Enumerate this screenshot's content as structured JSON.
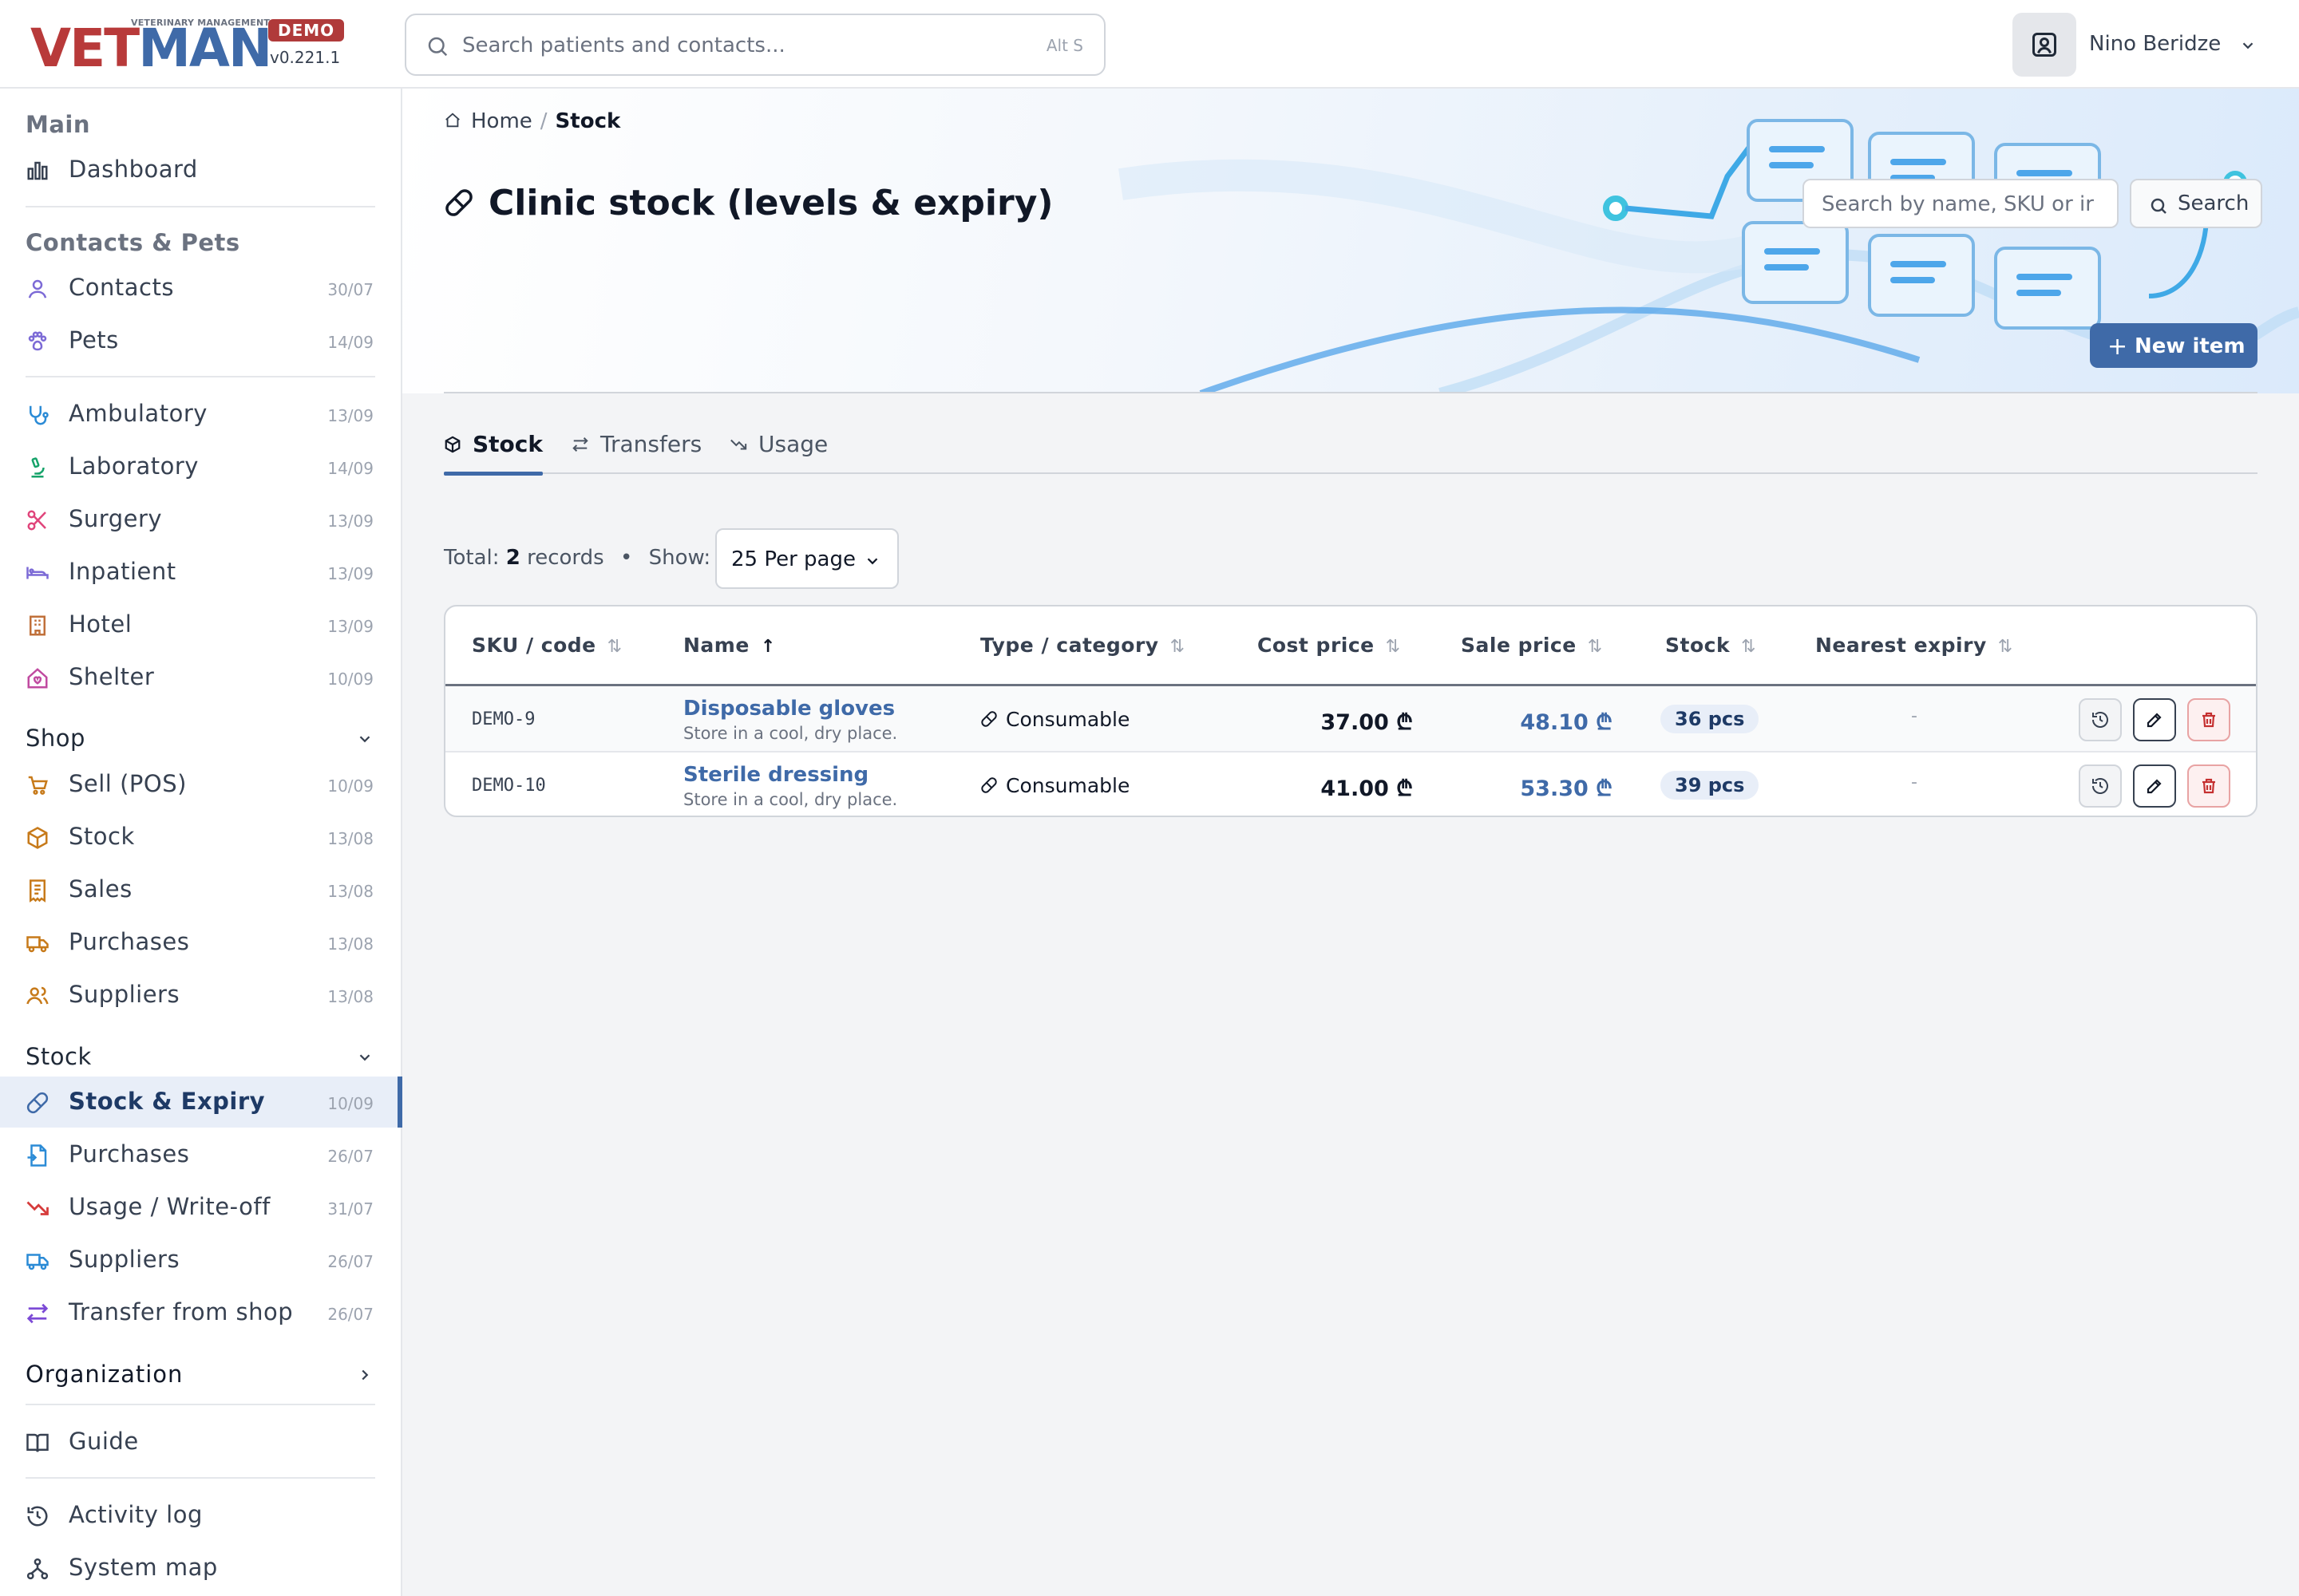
{
  "header": {
    "logo_sub": "VETERINARY MANAGEMENT",
    "logo_vet": "VET",
    "logo_man": "MAN",
    "badge": "DEMO",
    "version": "v0.221.1",
    "search_placeholder": "Search patients and contacts...",
    "search_shortcut": "Alt S",
    "user_name": "Nino Beridze"
  },
  "sidebar": {
    "main_title": "Main",
    "dashboard": "Dashboard",
    "contacts_title": "Contacts & Pets",
    "contacts": {
      "label": "Contacts",
      "date": "30/07"
    },
    "pets": {
      "label": "Pets",
      "date": "14/09"
    },
    "ambulatory": {
      "label": "Ambulatory",
      "date": "13/09"
    },
    "laboratory": {
      "label": "Laboratory",
      "date": "14/09"
    },
    "surgery": {
      "label": "Surgery",
      "date": "13/09"
    },
    "inpatient": {
      "label": "Inpatient",
      "date": "13/09"
    },
    "hotel": {
      "label": "Hotel",
      "date": "13/09"
    },
    "shelter": {
      "label": "Shelter",
      "date": "10/09"
    },
    "shop_title": "Shop",
    "sell": {
      "label": "Sell (POS)",
      "date": "10/09"
    },
    "shop_stock": {
      "label": "Stock",
      "date": "13/08"
    },
    "sales": {
      "label": "Sales",
      "date": "13/08"
    },
    "shop_purchases": {
      "label": "Purchases",
      "date": "13/08"
    },
    "shop_suppliers": {
      "label": "Suppliers",
      "date": "13/08"
    },
    "stock_title": "Stock",
    "stock_expiry": {
      "label": "Stock & Expiry",
      "date": "10/09"
    },
    "stock_purchases": {
      "label": "Purchases",
      "date": "26/07"
    },
    "usage": {
      "label": "Usage / Write-off",
      "date": "31/07"
    },
    "stock_suppliers": {
      "label": "Suppliers",
      "date": "26/07"
    },
    "transfer": {
      "label": "Transfer from shop",
      "date": "26/07"
    },
    "organization_title": "Organization",
    "guide": "Guide",
    "activity": "Activity log",
    "system_map": "System map"
  },
  "breadcrumb": {
    "home": "Home",
    "sep": "/",
    "current": "Stock"
  },
  "page": {
    "title": "Clinic stock (levels & expiry)",
    "search_placeholder": "Search by name, SKU or ir",
    "search_button": "Search",
    "new_button": "New item",
    "new_plus": "+"
  },
  "tabs": {
    "stock": "Stock",
    "transfers": "Transfers",
    "usage": "Usage"
  },
  "list": {
    "total_prefix": "Total:",
    "total_count": "2",
    "total_suffix": "records",
    "dot": "•",
    "show": "Show:",
    "per_page": "25 Per page"
  },
  "table": {
    "columns": {
      "sku": "SKU / code",
      "name": "Name",
      "type": "Type / category",
      "cost": "Cost price",
      "sale": "Sale price",
      "stock": "Stock",
      "expiry": "Nearest expiry"
    },
    "sort_icon": "⇅",
    "sort_active_icon": "↑",
    "rows": [
      {
        "sku": "DEMO-9",
        "name": "Disposable gloves",
        "desc": "Store in a cool, dry place.",
        "type": "Consumable",
        "cost": "37.00 ₾",
        "sale": "48.10 ₾",
        "stock": "36 pcs",
        "expiry": "-"
      },
      {
        "sku": "DEMO-10",
        "name": "Sterile dressing",
        "desc": "Store in a cool, dry place.",
        "type": "Consumable",
        "cost": "41.00 ₾",
        "sale": "53.30 ₾",
        "stock": "39 pcs",
        "expiry": "-"
      }
    ]
  },
  "colors": {
    "brand_blue": "#3f6aa8",
    "brand_red": "#b83a3a",
    "delete_red": "#c53030"
  },
  "icons": {
    "dashboard": "bar-chart-icon",
    "contacts": "user-icon",
    "pets": "paw-icon",
    "ambulatory": "stethoscope-icon",
    "laboratory": "microscope-icon",
    "surgery": "scissors-icon",
    "inpatient": "bed-icon",
    "hotel": "building-icon",
    "shelter": "house-heart-icon",
    "sell": "cart-icon",
    "stock": "box-icon",
    "sales": "receipt-icon",
    "purchases": "truck-icon",
    "suppliers": "users-icon",
    "stock_expiry": "pill-icon",
    "usage": "trend-down-icon",
    "transfer": "arrows-icon",
    "guide": "book-icon",
    "activity": "history-icon",
    "system_map": "sitemap-icon"
  }
}
